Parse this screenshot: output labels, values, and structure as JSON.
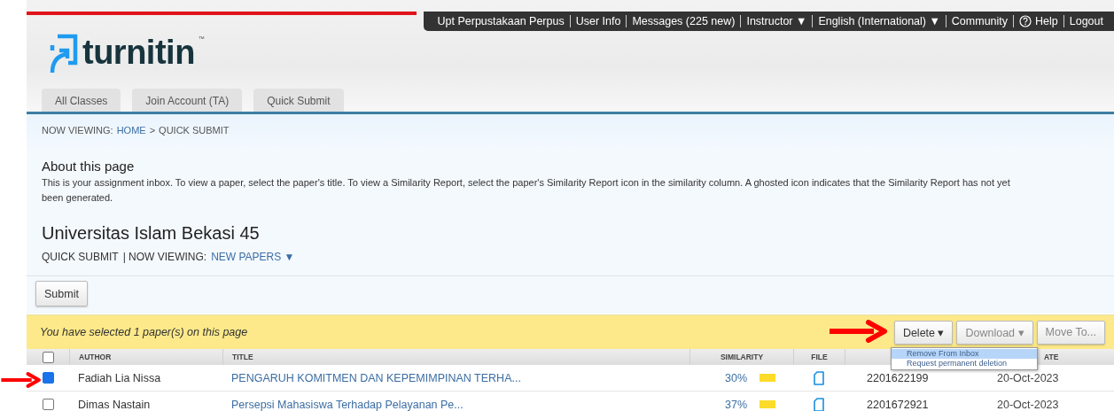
{
  "top_bar": {
    "links": [
      {
        "label": "Upt Perpustakaan Perpus",
        "kind": "text"
      },
      {
        "label": "User Info",
        "kind": "text"
      },
      {
        "label": "Messages (225 new)",
        "kind": "text"
      },
      {
        "label": "Instructor ▼",
        "kind": "text"
      },
      {
        "label": "English (International) ▼",
        "kind": "text"
      },
      {
        "label": "Community",
        "kind": "text"
      },
      {
        "label": "Help",
        "kind": "help"
      },
      {
        "label": "Logout",
        "kind": "text"
      }
    ]
  },
  "logo": {
    "text": "turnitin",
    "mark": "™"
  },
  "tabs": [
    {
      "label": "All Classes",
      "selected": false
    },
    {
      "label": "Join Account (TA)",
      "selected": false
    },
    {
      "label": "Quick Submit",
      "selected": false
    }
  ],
  "breadcrumb": {
    "prefix": "NOW VIEWING:",
    "link": "HOME",
    "separator": ">",
    "current": "QUICK SUBMIT"
  },
  "about": {
    "title": "About this page",
    "text": "This is your assignment inbox. To view a paper, select the paper's title. To view a Similarity Report, select the paper's Similarity Report icon in the similarity column. A ghosted icon indicates that the Similarity Report has not yet been generated."
  },
  "class_title": "Universitas Islam Bekasi 45",
  "subnav": {
    "label": "QUICK SUBMIT",
    "viewing": "| NOW VIEWING:",
    "filter": "NEW PAPERS ▼"
  },
  "submit_button": "Submit",
  "selection_bar": {
    "message": "You have selected 1 paper(s) on this page",
    "buttons": [
      {
        "label": "Delete ▾",
        "disabled": false
      },
      {
        "label": "Download ▾",
        "disabled": true
      },
      {
        "label": "Move To...",
        "disabled": true
      }
    ]
  },
  "delete_menu": [
    {
      "label": "Remove From Inbox",
      "selected": true
    },
    {
      "label": "Request permanent deletion",
      "selected": false
    }
  ],
  "table": {
    "header_checked": false,
    "columns": [
      "AUTHOR",
      "TITLE",
      "SIMILARITY",
      "FILE",
      "ATE"
    ],
    "rows": [
      {
        "checked": true,
        "author": "Fadiah Lia Nissa",
        "title": "PENGARUH KOMITMEN DAN KEPEMIMPINAN TERHA...",
        "similarity": "30%",
        "color": "#fddb2a",
        "paper_id": "2201622199",
        "date": "20-Oct-2023"
      },
      {
        "checked": false,
        "author": "Dimas Nastain",
        "title": "Persepsi Mahasiswa Terhadap Pelayanan Pe...",
        "similarity": "37%",
        "color": "#fddb2a",
        "paper_id": "2201672921",
        "date": "20-Oct-2023"
      }
    ]
  }
}
